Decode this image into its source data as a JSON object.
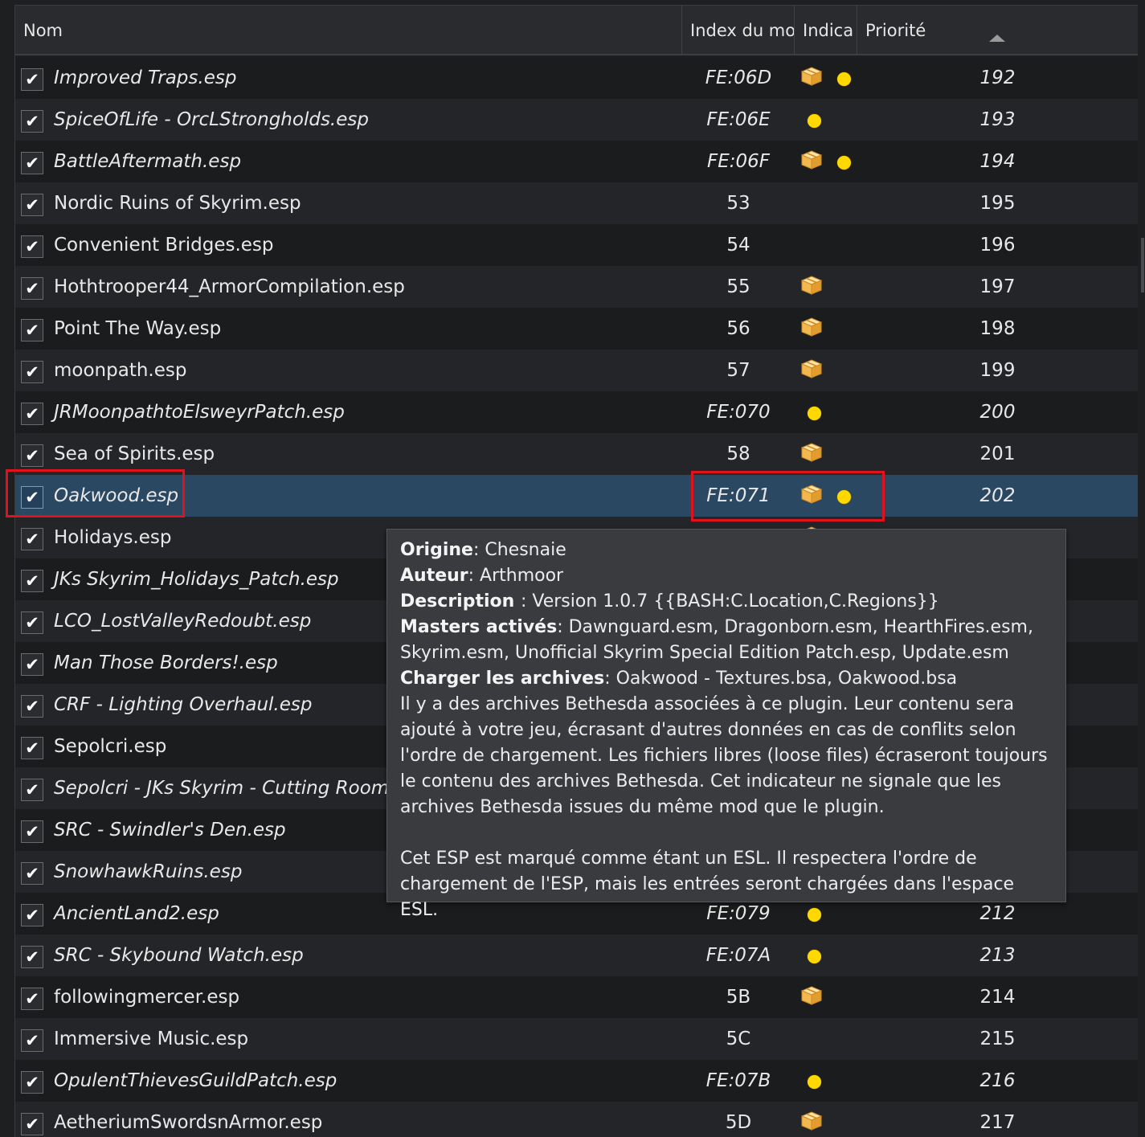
{
  "header": {
    "col_name": "Nom",
    "col_index": "Index du mo",
    "col_flags": "Indica",
    "col_priority": "Priorité"
  },
  "plugins": [
    {
      "name": "Improved Traps.esp",
      "index": "FE:06D",
      "priority": "192",
      "italic": true,
      "archive_icon": true,
      "light_icon": true
    },
    {
      "name": "SpiceOfLife - OrcLStrongholds.esp",
      "index": "FE:06E",
      "priority": "193",
      "italic": true,
      "archive_icon": false,
      "light_icon": true
    },
    {
      "name": "BattleAftermath.esp",
      "index": "FE:06F",
      "priority": "194",
      "italic": true,
      "archive_icon": true,
      "light_icon": true
    },
    {
      "name": "Nordic Ruins of Skyrim.esp",
      "index": "53",
      "priority": "195",
      "italic": false,
      "archive_icon": false,
      "light_icon": false
    },
    {
      "name": "Convenient Bridges.esp",
      "index": "54",
      "priority": "196",
      "italic": false,
      "archive_icon": false,
      "light_icon": false
    },
    {
      "name": "Hothtrooper44_ArmorCompilation.esp",
      "index": "55",
      "priority": "197",
      "italic": false,
      "archive_icon": true,
      "light_icon": false
    },
    {
      "name": "Point The Way.esp",
      "index": "56",
      "priority": "198",
      "italic": false,
      "archive_icon": true,
      "light_icon": false
    },
    {
      "name": "moonpath.esp",
      "index": "57",
      "priority": "199",
      "italic": false,
      "archive_icon": true,
      "light_icon": false
    },
    {
      "name": "JRMoonpathtoElsweyrPatch.esp",
      "index": "FE:070",
      "priority": "200",
      "italic": true,
      "archive_icon": false,
      "light_icon": true
    },
    {
      "name": "Sea of Spirits.esp",
      "index": "58",
      "priority": "201",
      "italic": false,
      "archive_icon": true,
      "light_icon": false
    },
    {
      "name": "Oakwood.esp",
      "index": "FE:071",
      "priority": "202",
      "italic": true,
      "archive_icon": true,
      "light_icon": true,
      "selected": true
    },
    {
      "name": "Holidays.esp",
      "index": "",
      "priority": "",
      "italic": false,
      "archive_icon": true,
      "light_icon": false
    },
    {
      "name": "JKs Skyrim_Holidays_Patch.esp",
      "index": "",
      "priority": "",
      "italic": true,
      "archive_icon": false,
      "light_icon": false
    },
    {
      "name": "LCO_LostValleyRedoubt.esp",
      "index": "",
      "priority": "",
      "italic": true,
      "archive_icon": false,
      "light_icon": false
    },
    {
      "name": "Man Those Borders!.esp",
      "index": "",
      "priority": "",
      "italic": true,
      "archive_icon": false,
      "light_icon": false
    },
    {
      "name": "CRF - Lighting Overhaul.esp",
      "index": "",
      "priority": "",
      "italic": true,
      "archive_icon": false,
      "light_icon": false
    },
    {
      "name": "Sepolcri.esp",
      "index": "",
      "priority": "",
      "italic": false,
      "archive_icon": false,
      "light_icon": false
    },
    {
      "name": "Sepolcri - JKs Skyrim - Cutting Room Flo",
      "index": "",
      "priority": "",
      "italic": true,
      "archive_icon": false,
      "light_icon": false
    },
    {
      "name": "SRC - Swindler's Den.esp",
      "index": "",
      "priority": "",
      "italic": true,
      "archive_icon": false,
      "light_icon": false
    },
    {
      "name": "SnowhawkRuins.esp",
      "index": "",
      "priority": "",
      "italic": true,
      "archive_icon": false,
      "light_icon": false
    },
    {
      "name": "AncientLand2.esp",
      "index": "FE:079",
      "priority": "212",
      "italic": true,
      "archive_icon": false,
      "light_icon": true
    },
    {
      "name": "SRC - Skybound Watch.esp",
      "index": "FE:07A",
      "priority": "213",
      "italic": true,
      "archive_icon": false,
      "light_icon": true
    },
    {
      "name": "followingmercer.esp",
      "index": "5B",
      "priority": "214",
      "italic": false,
      "archive_icon": true,
      "light_icon": false
    },
    {
      "name": "Immersive Music.esp",
      "index": "5C",
      "priority": "215",
      "italic": false,
      "archive_icon": false,
      "light_icon": false
    },
    {
      "name": "OpulentThievesGuildPatch.esp",
      "index": "FE:07B",
      "priority": "216",
      "italic": true,
      "archive_icon": false,
      "light_icon": true
    },
    {
      "name": "AetheriumSwordsnArmor.esp",
      "index": "5D",
      "priority": "217",
      "italic": false,
      "archive_icon": true,
      "light_icon": false
    }
  ],
  "tooltip": {
    "origin_label": "Origine",
    "origin_value": ": Chesnaie",
    "author_label": "Auteur",
    "author_value": ": Arthmoor",
    "description_label": "Description ",
    "description_value": ": Version 1.0.7 {{BASH:C.Location,C.Regions}}",
    "masters_label": "Masters activés",
    "masters_value": ": Dawnguard.esm, Dragonborn.esm, HearthFires.esm, Skyrim.esm, Unofficial Skyrim Special Edition Patch.esp, Update.esm",
    "archives_label": "Charger les archives",
    "archives_value": ": Oakwood - Textures.bsa, Oakwood.bsa",
    "archives_note": "Il y a des archives Bethesda associées à ce plugin. Leur contenu sera ajouté à votre jeu, écrasant d'autres données en cas de conflits selon l'ordre de chargement. Les fichiers libres (loose files) écraseront toujours le contenu des archives Bethesda. Cet indicateur ne signale que les archives Bethesda issues du même mod que le plugin.",
    "esl_note": "Cet ESP est marqué comme étant un ESL. Il respectera l'ordre de chargement de l'ESP, mais les entrées seront chargées dans l'espace ESL."
  },
  "icons": {
    "checkbox": "check-mark",
    "archive": "package-box",
    "light_plugin": "yellow-dot",
    "sort": "sort-ascending-arrow"
  },
  "colors": {
    "selection": "#2b4862",
    "highlight_box": "#e0121e",
    "light_dot": "#ffd800"
  }
}
